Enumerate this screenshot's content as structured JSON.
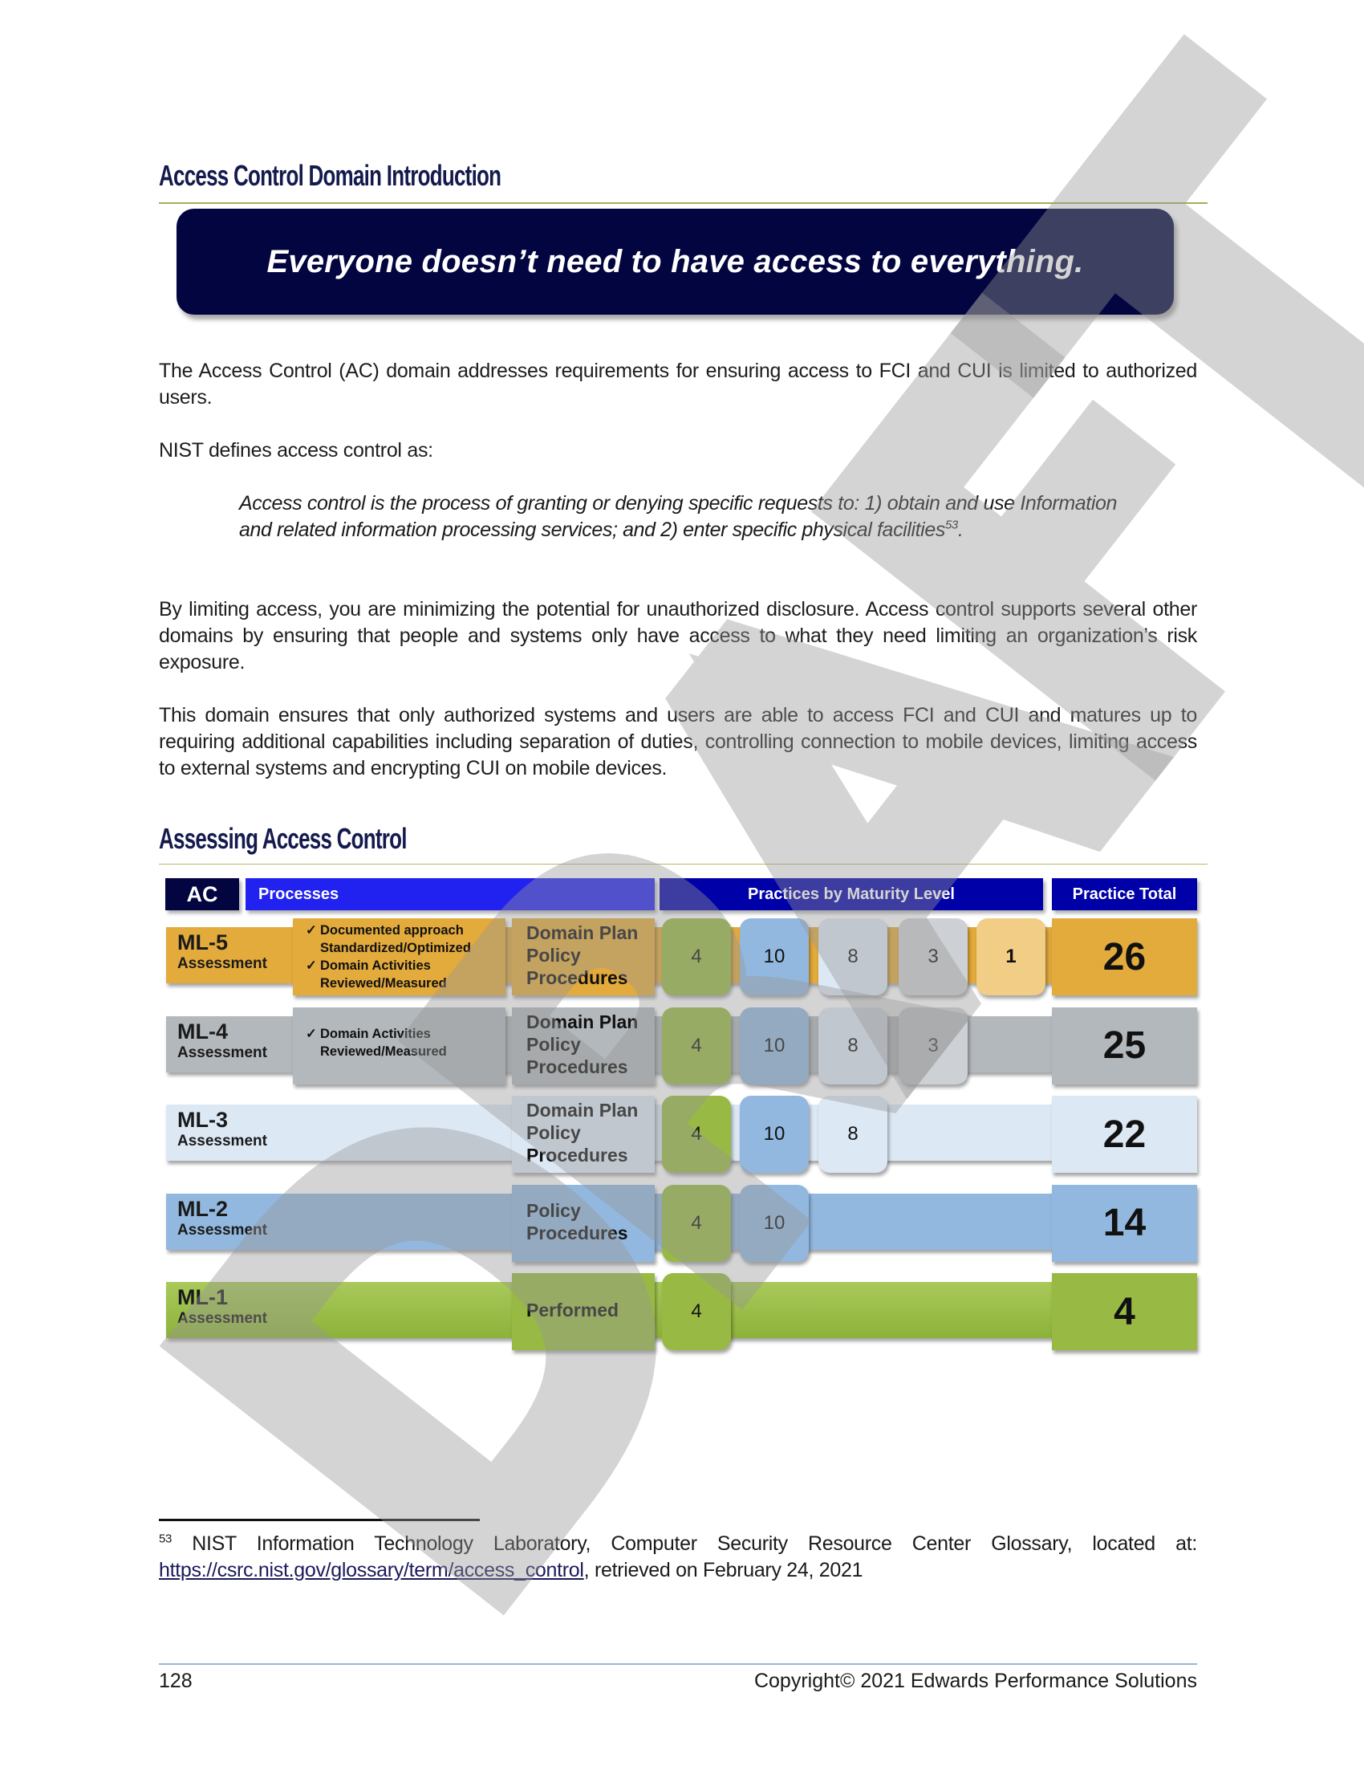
{
  "watermark": "DRAFT",
  "intro": {
    "heading": "Access Control Domain Introduction",
    "tagline": "Everyone doesn’t need to have access to everything.",
    "paragraph1": "The Access Control (AC) domain addresses requirements for ensuring access to FCI and CUI is limited to authorized users.",
    "paragraph2": "NIST defines access control as:",
    "quote": "Access control is the process of granting or denying specific requests to: 1) obtain and use Information and related information processing services; and 2) enter specific physical facilities",
    "quote_footnote_ref": "53",
    "quote_end": ".",
    "paragraph3": "By limiting access, you are minimizing the potential for unauthorized disclosure. Access control supports several other domains by ensuring that people and systems only have access to what they need limiting an organization’s risk exposure.",
    "paragraph4": "This domain ensures that only authorized systems and users are able to access FCI and CUI and matures up to requiring additional capabilities including separation of duties, controlling connection to mobile devices, limiting access to external systems and encrypting CUI on mobile devices."
  },
  "assessing": {
    "heading": "Assessing Access Control",
    "headers": {
      "domain": "AC",
      "processes": "Processes",
      "practices": "Practices by Maturity Level",
      "total": "Practice Total"
    },
    "colors": {
      "ml5": "#e3aa3c",
      "ml4": "#b3b8bc",
      "ml3": "#dde8f5",
      "ml2": "#93b8df",
      "ml1": "#98ba44",
      "ml5_light": "#f1cd86",
      "ml4_light": "#cdd1d5",
      "header_dark": "#02053f",
      "header_blue": "#2222f0",
      "header_navy": "#0000a8"
    },
    "rows": [
      {
        "level": "ML-5",
        "sub": "Assessment",
        "process_items": [
          {
            "check": "✓",
            "text": "Documented approach Standardized/Optimized"
          },
          {
            "check": "✓",
            "text": "Domain Activities Reviewed/Measured"
          }
        ],
        "docs": [
          "Domain Plan",
          "Policy",
          "Procedures"
        ],
        "practices": [
          4,
          10,
          8,
          3,
          1
        ],
        "total": 26
      },
      {
        "level": "ML-4",
        "sub": "Assessment",
        "process_items": [
          {
            "check": "✓",
            "text": "Domain Activities Reviewed/Measured"
          }
        ],
        "docs": [
          "Domain Plan",
          "Policy",
          "Procedures"
        ],
        "practices": [
          4,
          10,
          8,
          3
        ],
        "total": 25
      },
      {
        "level": "ML-3",
        "sub": "Assessment",
        "process_items": [],
        "docs": [
          "Domain Plan",
          "Policy",
          "Procedures"
        ],
        "practices": [
          4,
          10,
          8
        ],
        "total": 22
      },
      {
        "level": "ML-2",
        "sub": "Assessment",
        "process_items": [],
        "docs": [
          "Policy",
          "Procedures"
        ],
        "practices": [
          4,
          10
        ],
        "total": 14
      },
      {
        "level": "ML-1",
        "sub": "Assessment",
        "process_items": [],
        "docs": [
          "Performed"
        ],
        "practices": [
          4
        ],
        "total": 4
      }
    ]
  },
  "footnote": {
    "number": "53",
    "text": " NIST Information Technology Laboratory, Computer Security Resource Center Glossary, located at: ",
    "link": "https://csrc.nist.gov/glossary/term/access_control",
    "after": ", retrieved on February 24, 2021"
  },
  "footer": {
    "page_number": "128",
    "copyright": "Copyright© 2021 Edwards Performance Solutions"
  }
}
